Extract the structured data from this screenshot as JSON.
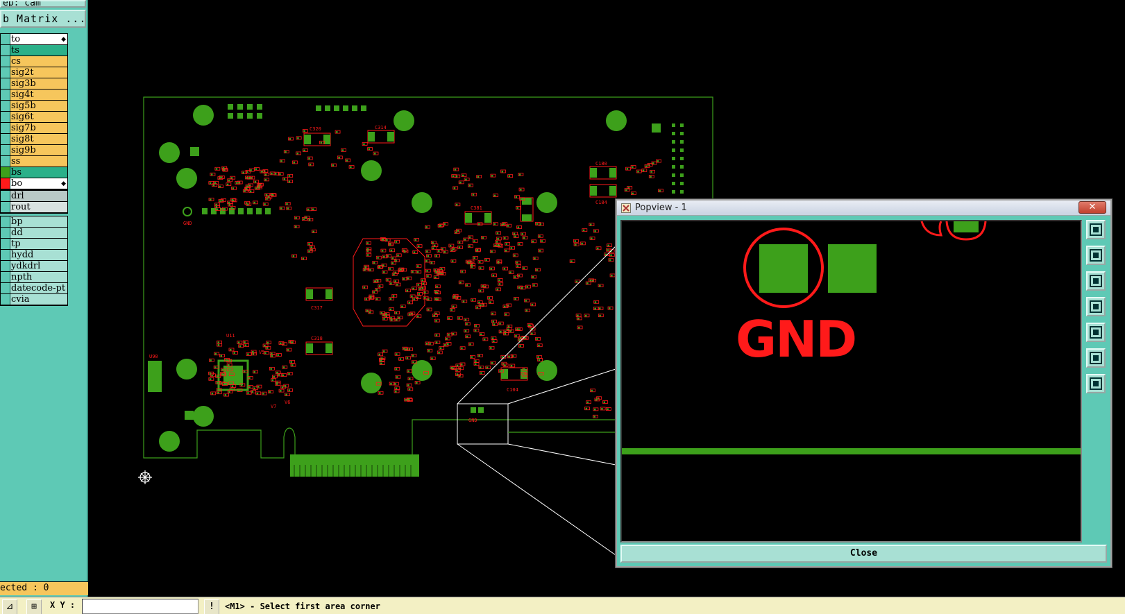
{
  "left_panel": {
    "step_text": "ep: cam",
    "matrix_button": "b Matrix ...",
    "layers": [
      {
        "name": "to",
        "color": "#ffffff",
        "swatch": "#5ec9b5",
        "active": true
      },
      {
        "name": "ts",
        "color": "#2bb089",
        "swatch": "#5ec9b5"
      },
      {
        "name": "cs",
        "color": "#f6c65c",
        "swatch": "#5ec9b5"
      },
      {
        "name": "sig2t",
        "color": "#f6c65c",
        "swatch": "#5ec9b5"
      },
      {
        "name": "sig3b",
        "color": "#f6c65c",
        "swatch": "#5ec9b5"
      },
      {
        "name": "sig4t",
        "color": "#f6c65c",
        "swatch": "#5ec9b5"
      },
      {
        "name": "sig5b",
        "color": "#f6c65c",
        "swatch": "#5ec9b5"
      },
      {
        "name": "sig6t",
        "color": "#f6c65c",
        "swatch": "#5ec9b5"
      },
      {
        "name": "sig7b",
        "color": "#f6c65c",
        "swatch": "#5ec9b5"
      },
      {
        "name": "sig8t",
        "color": "#f6c65c",
        "swatch": "#5ec9b5"
      },
      {
        "name": "sig9b",
        "color": "#f6c65c",
        "swatch": "#5ec9b5"
      },
      {
        "name": "ss",
        "color": "#f6c65c",
        "swatch": "#5ec9b5"
      },
      {
        "name": "bs",
        "color": "#2bb089",
        "swatch": "#3da01b"
      },
      {
        "name": "bo",
        "color": "#ffffff",
        "swatch": "#ff1a1a",
        "active": true
      }
    ],
    "drill_layers": [
      {
        "name": "drl",
        "color": "#b9c9c6"
      },
      {
        "name": "rout",
        "color": "#d8e2e0"
      }
    ],
    "misc_layers": [
      {
        "name": "bp"
      },
      {
        "name": "dd"
      },
      {
        "name": "tp"
      },
      {
        "name": "hydd"
      },
      {
        "name": "ydkdrl"
      },
      {
        "name": "npth"
      },
      {
        "name": "datecode-pt"
      },
      {
        "name": "cvia"
      }
    ],
    "selected_text": "ected : 0"
  },
  "status_bar": {
    "xy_label": "X Y :",
    "xy_value": "",
    "message": "<M1> - Select first area corner"
  },
  "pcb": {
    "board_color": "#3da01b",
    "silk_color": "#ff1a1a",
    "labels": [
      "C320",
      "C314",
      "C180",
      "C184",
      "C381",
      "C317",
      "C318",
      "C104",
      "GND",
      "U11",
      "U90",
      "V5",
      "V6",
      "V7"
    ]
  },
  "popview": {
    "title": "Popview - 1",
    "close_label": "Close",
    "gnd_label": "GND",
    "tools": [
      "zoom-home-icon",
      "pan-up-icon",
      "pan-down-icon",
      "pan-left-icon",
      "pan-right-icon",
      "zoom-in-icon",
      "zoom-out-icon"
    ]
  },
  "colors": {
    "panel_bg": "#5ec9b5",
    "copper": "#3da01b",
    "silkscreen": "#ff1a1a",
    "outline": "#3da01b",
    "status_bar": "#f3f0c4"
  }
}
